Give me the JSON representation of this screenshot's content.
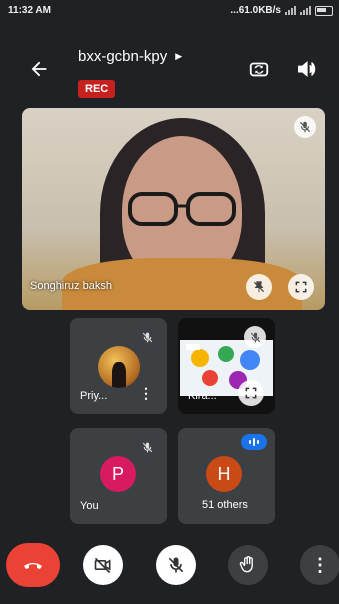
{
  "status_bar": {
    "time": "11:32 AM",
    "network_speed": "...61.0KB/s"
  },
  "header": {
    "meeting_code": "bxx-gcbn-kpy",
    "rec_label": "REC"
  },
  "main_tile": {
    "name": "Songhiruz baksh"
  },
  "tiles": {
    "priya": {
      "name": "Priy...",
      "more": "⋮"
    },
    "kira": {
      "name": "Kira..."
    },
    "you": {
      "name": "You",
      "avatar_letter": "P",
      "avatar_color": "#d81b60"
    },
    "others": {
      "avatar_letter": "H",
      "avatar_color": "#c94a16",
      "label": "51 others"
    }
  },
  "controls": {
    "more": "⋮"
  },
  "colors": {
    "background": "#1f2124",
    "tile": "#3c4043",
    "end_call": "#ea4335",
    "rec": "#c5221f",
    "speaking": "#1a73e8"
  }
}
